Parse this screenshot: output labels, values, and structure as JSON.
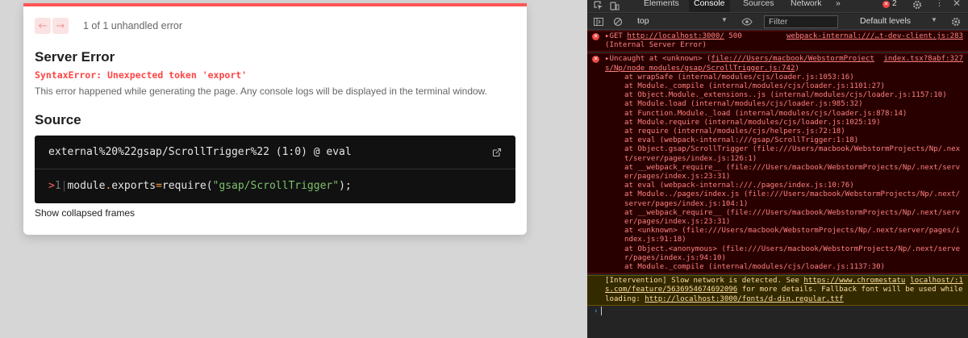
{
  "overlay": {
    "nav_prev": "←",
    "nav_next": "→",
    "error_count": "1 of 1 unhandled error",
    "title": "Server Error",
    "error_message": "SyntaxError: Unexpected token 'export'",
    "description": "This error happened while generating the page. Any console logs will be displayed in the terminal window.",
    "source_heading": "Source",
    "code_file": "external%20%22gsap/ScrollTrigger%22 (1:0) @ eval",
    "code_line": {
      "marker": ">",
      "line_number": "1",
      "pipe": "|",
      "t1": "module",
      "t2": ".",
      "t3": "exports",
      "t4": "=",
      "t5": "require(",
      "t6": "\"gsap/ScrollTrigger\"",
      "t7": ");"
    },
    "collapsed_frames": "Show collapsed frames",
    "accent_color": "#ff5555"
  },
  "devtools": {
    "tabs": [
      "Elements",
      "Console",
      "Sources",
      "Network",
      "»"
    ],
    "error_badge": "2",
    "context": "top",
    "filter_placeholder": "Filter",
    "levels": "Default levels",
    "messages": {
      "get_error": {
        "text": "▸GET ",
        "url": "http://localhost:3000/",
        "status": " 500 ",
        "status_text": "(Internal Server Error)",
        "source": "webpack-internal:///…t-dev-client.js:283"
      },
      "uncaught": {
        "head": "▸Uncaught     at <unknown> (",
        "head_link": "file:///Users/macbook/WebstormProjects/Np/node_modules/gsap/ScrollTrigger.js:742",
        "head_end": ")",
        "source": "index.tsx?8abf:327",
        "stack": [
          "at wrapSafe (internal/modules/cjs/loader.js:1053:16)",
          "at Module._compile (internal/modules/cjs/loader.js:1101:27)",
          "at Object.Module._extensions..js (internal/modules/cjs/loader.js:1157:10)",
          "at Module.load (internal/modules/cjs/loader.js:985:32)",
          "at Function.Module._load (internal/modules/cjs/loader.js:878:14)",
          "at Module.require (internal/modules/cjs/loader.js:1025:19)",
          "at require (internal/modules/cjs/helpers.js:72:18)",
          "at eval (webpack-internal:///gsap/ScrollTrigger:1:18)",
          "at Object.gsap/ScrollTrigger (file:///Users/macbook/WebstormProjects/Np/.next/server/pages/index.js:126:1)",
          "at __webpack_require__ (file:///Users/macbook/WebstormProjects/Np/.next/server/pages/index.js:23:31)",
          "at eval (webpack-internal:///./pages/index.js:10:76)",
          "at Module../pages/index.js (file:///Users/macbook/WebstormProjects/Np/.next/server/pages/index.js:104:1)",
          "at __webpack_require__ (file:///Users/macbook/WebstormProjects/Np/.next/server/pages/index.js:23:31)",
          "at <unknown> (file:///Users/macbook/WebstormProjects/Np/.next/server/pages/index.js:91:18)",
          "at Object.<anonymous> (file:///Users/macbook/WebstormProjects/Np/.next/server/pages/index.js:94:10)",
          "at Module._compile (internal/modules/cjs/loader.js:1137:30)"
        ]
      },
      "intervention": {
        "text": "[Intervention] Slow network is detected. See ",
        "link": "https://www.chromestatus.com/feature/5636954674692096",
        "text2": " for more details. Fallback font will be used while loading: ",
        "link2": "http://localhost:3000/fonts/d-din.regular.ttf",
        "source": "localhost/:1"
      }
    },
    "prompt_symbol": "›"
  }
}
